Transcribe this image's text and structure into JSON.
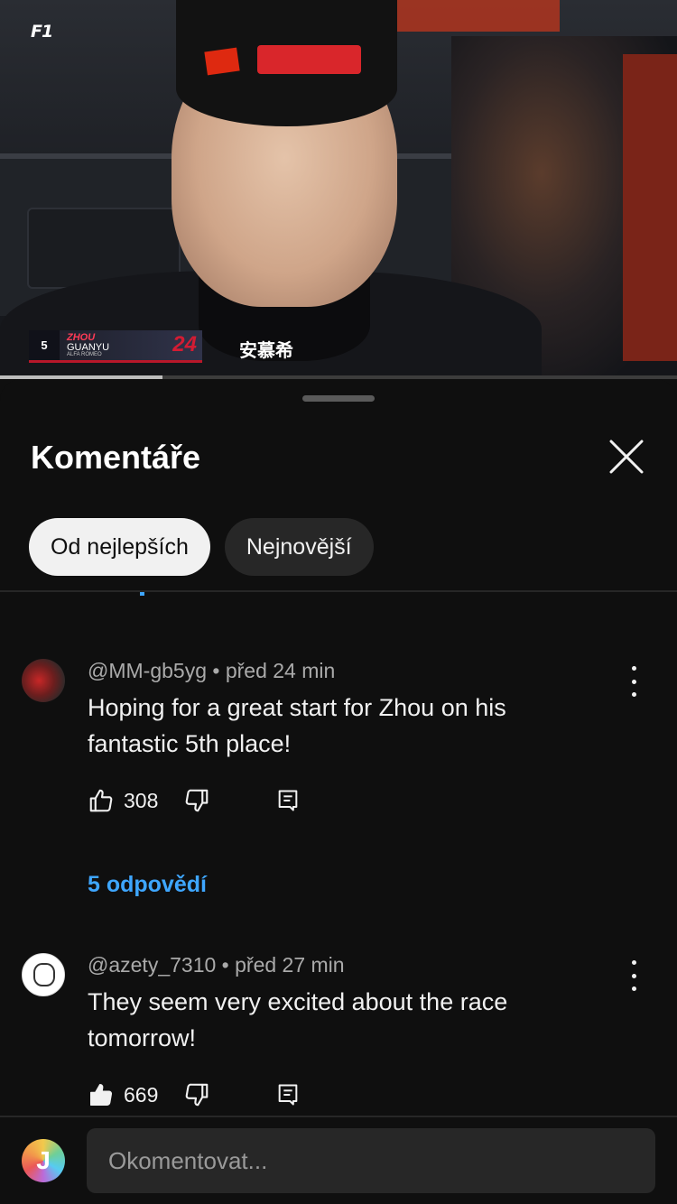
{
  "video": {
    "brand_logo": "F1",
    "lower_third": {
      "position": "5",
      "first_name": "ZHOU",
      "last_name": "GUANYU",
      "team": "ALFA ROMEO",
      "car_number": "24"
    },
    "collar_text": "安慕希",
    "progress_percent": 24
  },
  "sheet": {
    "title": "Komentáře",
    "close_icon": "close-icon",
    "sort_chips": [
      {
        "label": "Od nejlepších",
        "active": true
      },
      {
        "label": "Nejnovější",
        "active": false
      }
    ]
  },
  "comments": [
    {
      "author": "@MM-gb5yg",
      "time": "před 24 min",
      "text": "Hoping for a great start for Zhou on his fantastic 5th place!",
      "likes": "308",
      "liked": false,
      "replies_label": "5 odpovědí"
    },
    {
      "author": "@azety_7310",
      "time": "před 27 min",
      "text": "They seem very excited about the race tomorrow!",
      "likes": "669",
      "liked": true
    }
  ],
  "composer": {
    "avatar_letter": "J",
    "placeholder": "Okomentovat..."
  },
  "colors": {
    "background": "#0f0f0f",
    "accent_link": "#3ea6ff",
    "chip_active": "#f1f1f1",
    "chip_inactive": "#272727"
  }
}
